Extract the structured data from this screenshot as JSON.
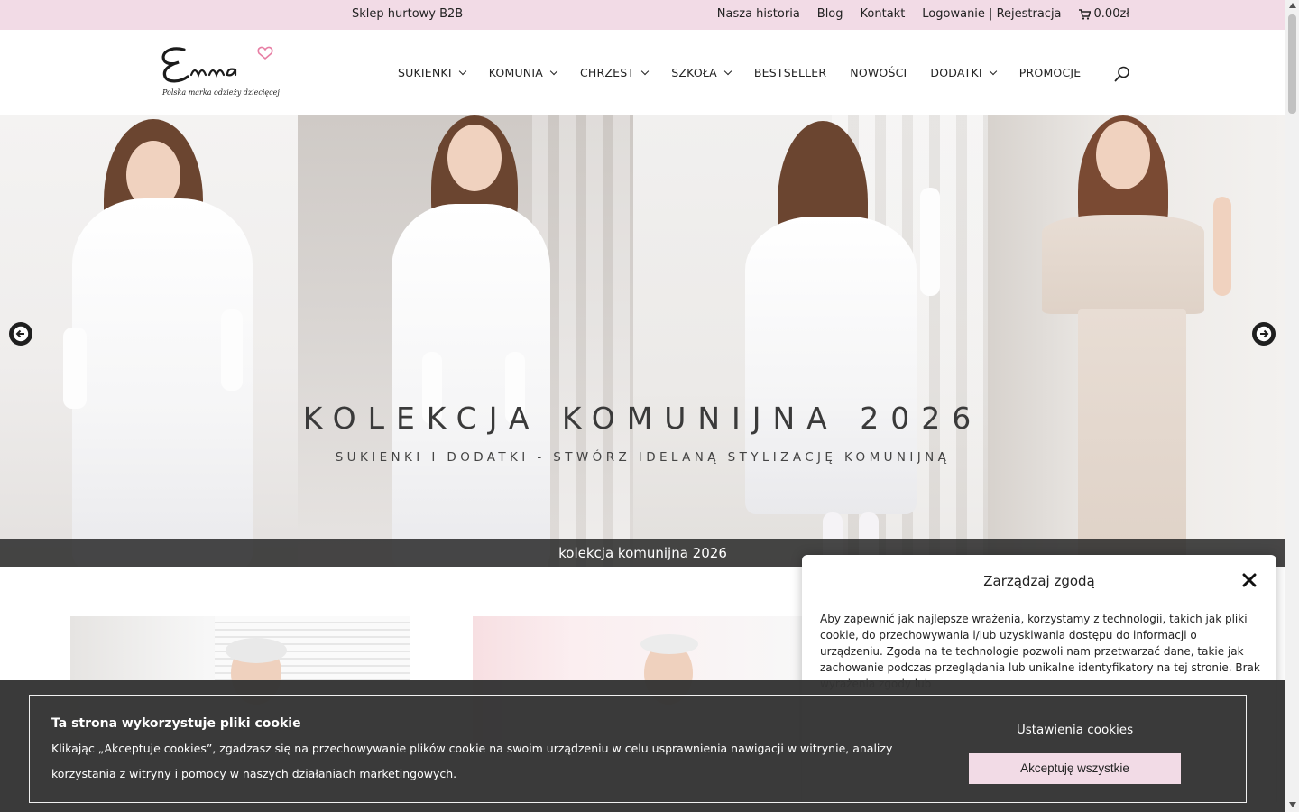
{
  "topbar": {
    "b2b": "Sklep hurtowy B2B",
    "links": [
      "Nasza historia",
      "Blog",
      "Kontakt",
      "Logowanie | Rejestracja"
    ],
    "cart_total": "0.00zł"
  },
  "header": {
    "logo_text": "Emma",
    "logo_tagline": "Polska marka odzieży dziecięcej",
    "nav": [
      "SUKIENKI",
      "KOMUNIA",
      "CHRZEST",
      "SZKOŁA",
      "BESTSELLER",
      "NOWOŚCI",
      "DODATKI",
      "PROMOCJE"
    ]
  },
  "slider": {
    "title": "KOLEKCJA KOMUNIJNA 2026",
    "subtitle": "SUKIENKI I DODATKI - STWÓRZ IDELANĄ STYLIZACJĘ KOMUNIJNĄ",
    "caption": "kolekcja komunijna 2026"
  },
  "consent_modal": {
    "title": "Zarządzaj zgodą",
    "text": "Aby zapewnić jak najlepsze wrażenia, korzystamy z technologii, takich jak pliki cookie, do przechowywania i/lub uzyskiwania dostępu do informacji o urządzeniu. Zgoda na te technologie pozwoli nam przetwarzać dane, takie jak zachowanie podczas przeglądania lub unikalne identyfikatory na tej stronie. Brak wyrażenia zgody lub"
  },
  "cookie_banner": {
    "title": "Ta strona wykorzystuje pliki cookie",
    "text": "Klikając „Akceptuje cookies”, zgadzasz się na przechowywanie plików cookie na swoim urządzeniu w celu usprawnienia nawigacji w witrynie, analizy korzystania z witryny i pomocy w naszych działaniach marketingowych.",
    "settings_label": "Ustawienia cookies",
    "accept_label": "Akceptuję wszystkie"
  },
  "colors": {
    "topbar_bg": "#f2dbe6",
    "accent_pink": "#f2dbe6",
    "banner_bg": "#343434"
  }
}
